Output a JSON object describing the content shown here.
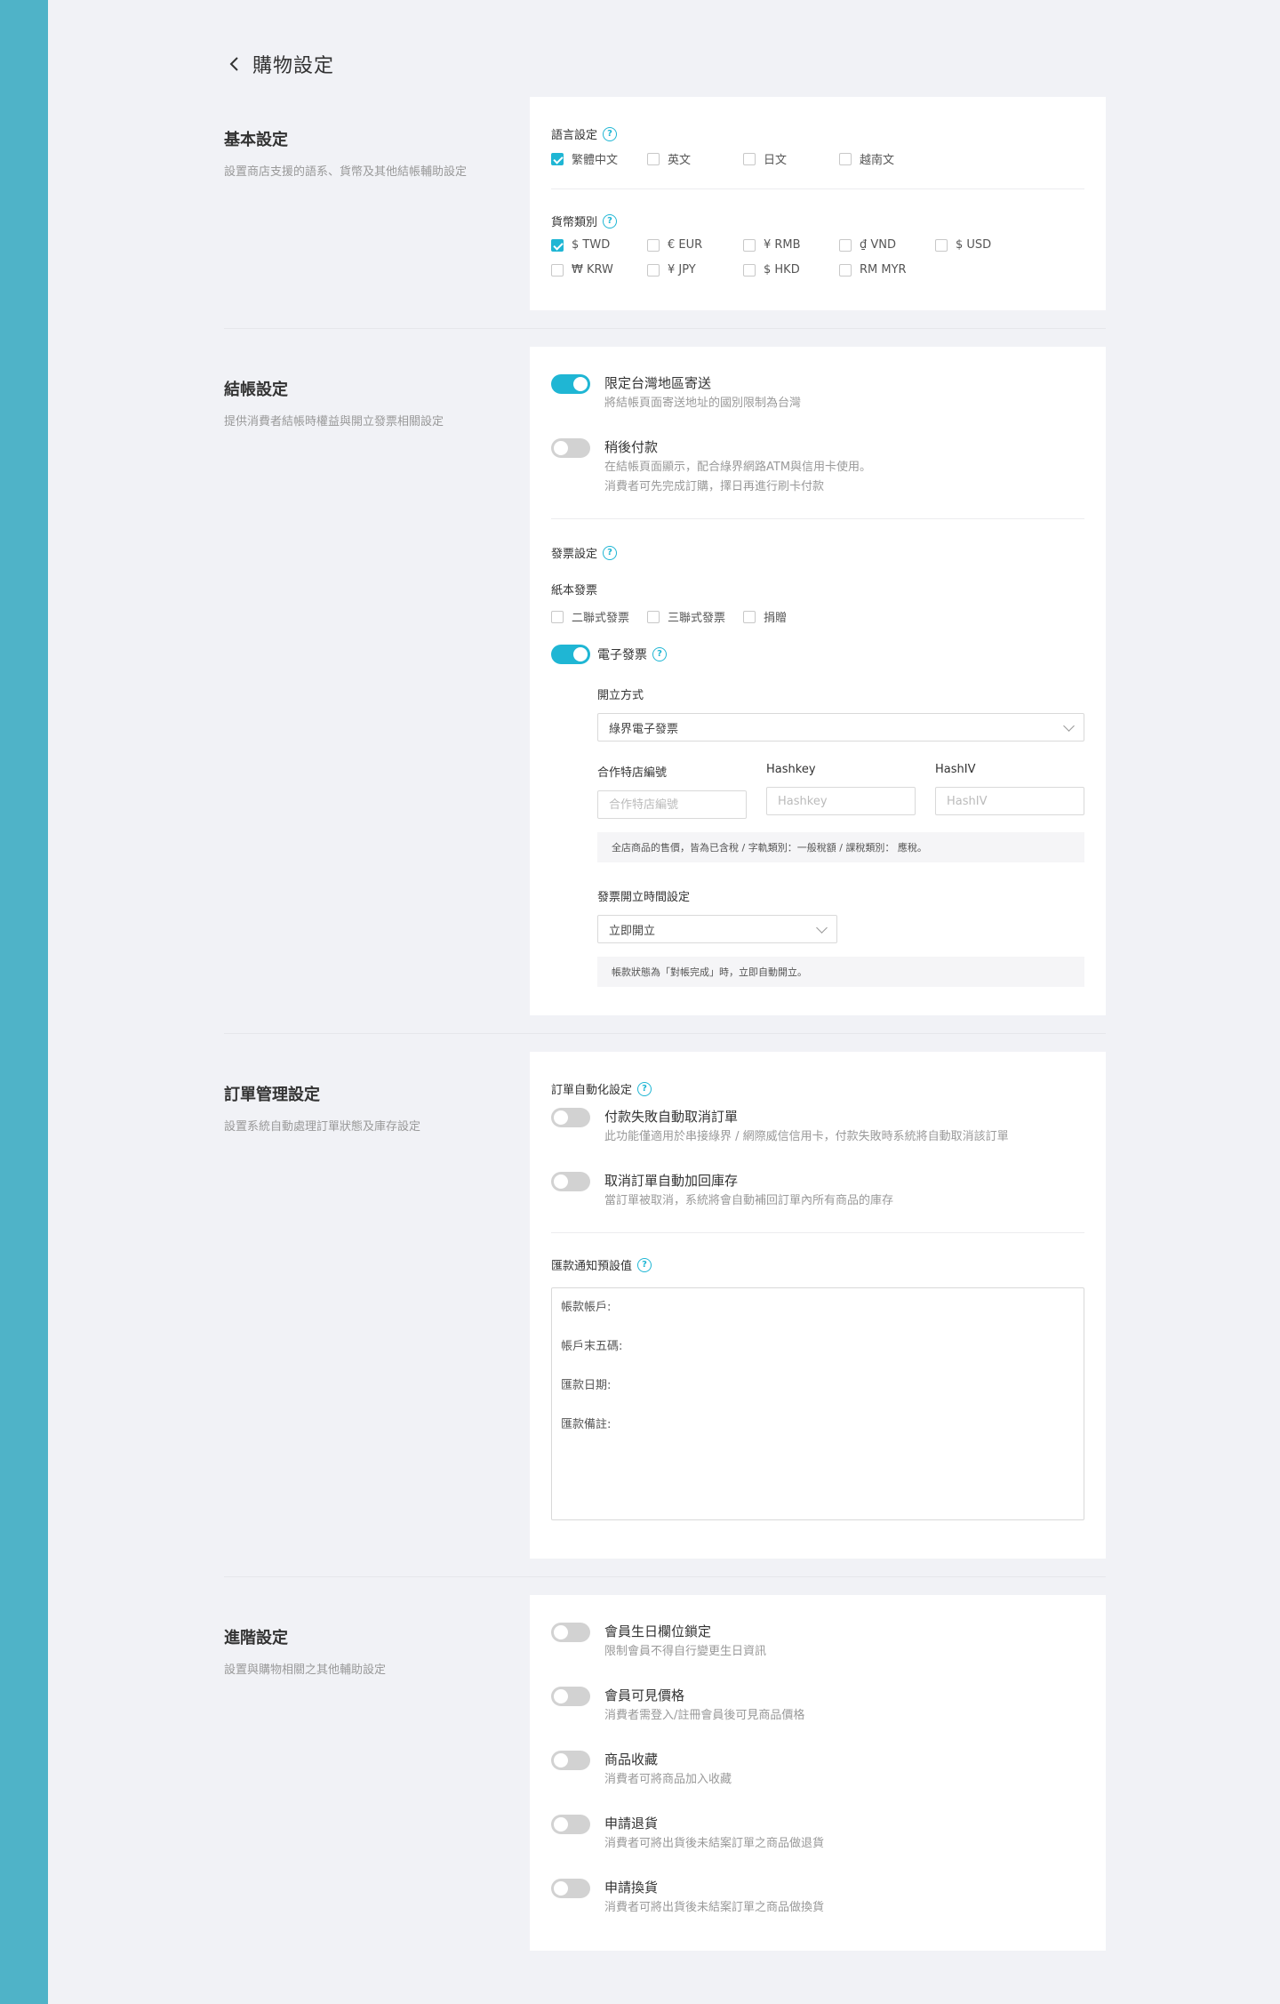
{
  "header": {
    "title": "購物設定"
  },
  "basic": {
    "title": "基本設定",
    "desc": "設置商店支援的語系、貨幣及其他結帳輔助設定",
    "language_label": "語言設定",
    "languages": [
      {
        "label": "繁體中文",
        "checked": true
      },
      {
        "label": "英文",
        "checked": false
      },
      {
        "label": "日文",
        "checked": false
      },
      {
        "label": "越南文",
        "checked": false
      }
    ],
    "currency_label": "貨幣類別",
    "currencies_row1": [
      {
        "label": "$ TWD",
        "checked": true
      },
      {
        "label": "€ EUR",
        "checked": false
      },
      {
        "label": "¥ RMB",
        "checked": false
      },
      {
        "label": "₫ VND",
        "checked": false
      },
      {
        "label": "$ USD",
        "checked": false
      }
    ],
    "currencies_row2": [
      {
        "label": "₩ KRW",
        "checked": false
      },
      {
        "label": "¥ JPY",
        "checked": false
      },
      {
        "label": "$ HKD",
        "checked": false
      },
      {
        "label": "RM MYR",
        "checked": false
      }
    ]
  },
  "checkout": {
    "title": "結帳設定",
    "desc": "提供消費者結帳時權益與開立發票相關設定",
    "toggle_taiwan": {
      "title": "限定台灣地區寄送",
      "desc": "將結帳頁面寄送地址的國別限制為台灣",
      "on": true
    },
    "toggle_later": {
      "title": "稍後付款",
      "desc1": "在結帳頁面顯示，配合綠界網路ATM與信用卡使用。",
      "desc2": "消費者可先完成訂購，擇日再進行刷卡付款",
      "on": false
    },
    "invoice_label": "發票設定",
    "paper_label": "紙本發票",
    "paper_options": [
      {
        "label": "二聯式發票",
        "checked": false
      },
      {
        "label": "三聯式發票",
        "checked": false
      },
      {
        "label": "捐贈",
        "checked": false
      }
    ],
    "einvoice_label": "電子發票",
    "einvoice_on": true,
    "method_label": "開立方式",
    "method_value": "綠界電子發票",
    "merchant_label": "合作特店編號",
    "merchant_placeholder": "合作特店編號",
    "hashkey_label": "Hashkey",
    "hashkey_placeholder": "Hashkey",
    "hashiv_label": "HashIV",
    "hashiv_placeholder": "HashIV",
    "tax_note": "全店商品的售價，皆為已含稅 / 字軌類別：一般稅額 / 課稅類別： 應稅。",
    "timing_label": "發票開立時間設定",
    "timing_value": "立即開立",
    "timing_note": "帳款狀態為「對帳完成」時，立即自動開立。"
  },
  "order": {
    "title": "訂單管理設定",
    "desc": "設置系統自動處理訂單狀態及庫存設定",
    "auto_label": "訂單自動化設定",
    "toggle_cancel": {
      "title": "付款失敗自動取消訂單",
      "desc": "此功能僅適用於串接綠界 / 網際威信信用卡，付款失敗時系統將自動取消該訂單",
      "on": false
    },
    "toggle_restock": {
      "title": "取消訂單自動加回庫存",
      "desc": "當訂單被取消，系統將會自動補回訂單內所有商品的庫存",
      "on": false
    },
    "remit_label": "匯款通知預設值",
    "remit_text": "帳款帳戶:\n帳戶末五碼:\n匯款日期:\n匯款備註:"
  },
  "advanced": {
    "title": "進階設定",
    "desc": "設置與購物相關之其他輔助設定",
    "toggles": [
      {
        "title": "會員生日欄位鎖定",
        "desc": "限制會員不得自行變更生日資訊",
        "on": false
      },
      {
        "title": "會員可見價格",
        "desc": "消費者需登入/註冊會員後可見商品價格",
        "on": false
      },
      {
        "title": "商品收藏",
        "desc": "消費者可將商品加入收藏",
        "on": false
      },
      {
        "title": "申請退貨",
        "desc": "消費者可將出貨後未結案訂單之商品做退貨",
        "on": false
      },
      {
        "title": "申請換貨",
        "desc": "消費者可將出貨後未結案訂單之商品做換貨",
        "on": false
      }
    ]
  },
  "colors": {
    "accent": "#1fb6d4",
    "sidebar": "#4fb3c8",
    "background": "#f1f2f6"
  }
}
